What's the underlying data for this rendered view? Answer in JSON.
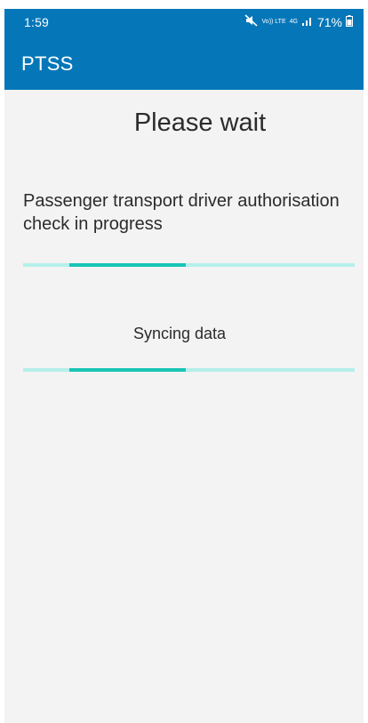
{
  "status_bar": {
    "time": "1:59",
    "mute_icon": "mute-icon",
    "volte_label": "Vo)) LTE",
    "network_label": "4G",
    "signal_icon": "signal-icon",
    "battery": "71%",
    "battery_icon": "battery-icon"
  },
  "app_bar": {
    "title": "PTSS"
  },
  "main": {
    "heading": "Please wait",
    "check_text": "Passenger transport driver authorisation check in progress",
    "sync_text": "Syncing data"
  },
  "colors": {
    "primary": "#0577b9",
    "background": "#f4f3f3",
    "progress_track": "#b5efea",
    "progress_fill": "#19c5b6"
  }
}
